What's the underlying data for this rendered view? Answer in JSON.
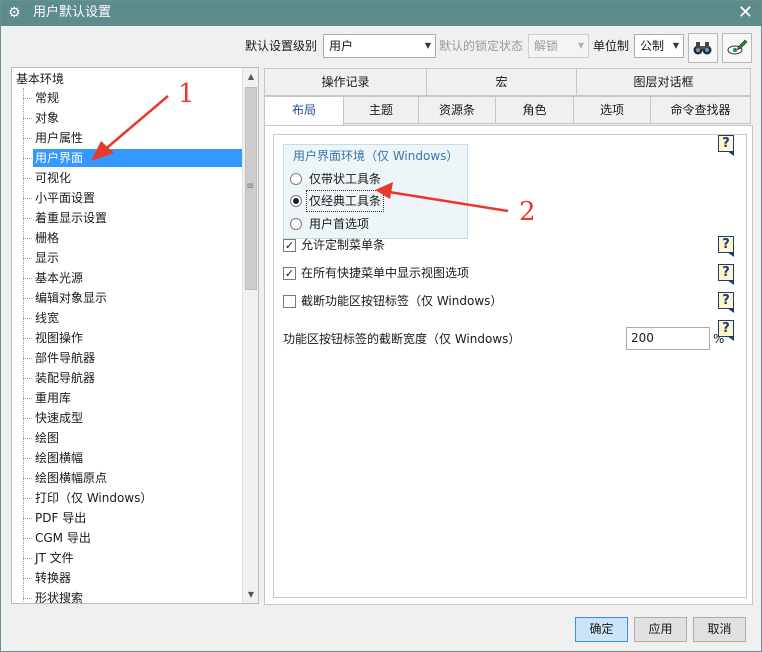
{
  "window": {
    "title": "用户默认设置",
    "app_icon": "gear-icon",
    "close_icon": "close-icon"
  },
  "toolbar": {
    "level_label": "默认设置级别",
    "level_value": "用户",
    "lock_label": "默认的锁定状态",
    "lock_value": "解锁",
    "unit_label": "单位制",
    "unit_value": "公制",
    "find_icon": "binoculars-icon",
    "tool_icon": "pencil-eye-icon"
  },
  "tree": {
    "root": "基本环境",
    "items": [
      "常规",
      "对象",
      "用户属性",
      "用户界面",
      "可视化",
      "小平面设置",
      "着重显示设置",
      "栅格",
      "显示",
      "基本光源",
      "编辑对象显示",
      "线宽",
      "视图操作",
      "部件导航器",
      "装配导航器",
      "重用库",
      "快速成型",
      "绘图",
      "绘图横幅",
      "绘图横幅原点",
      "打印（仅 Windows）",
      "PDF 导出",
      "CGM 导出",
      "JT 文件",
      "转换器",
      "形状搜索"
    ],
    "selected_index": 3
  },
  "tabs": {
    "row1": [
      "操作记录",
      "宏",
      "图层对话框"
    ],
    "row2": [
      "布局",
      "主题",
      "资源条",
      "角色",
      "选项",
      "命令查找器"
    ],
    "active": "布局"
  },
  "panel": {
    "group_title": "用户界面环境（仅 Windows）",
    "radios": [
      {
        "label": "仅带状工具条",
        "checked": false
      },
      {
        "label": "仅经典工具条",
        "checked": true
      },
      {
        "label": "用户首选项",
        "checked": false
      }
    ],
    "checks": [
      {
        "label": "允许定制菜单条",
        "checked": true
      },
      {
        "label": "在所有快捷菜单中显示视图选项",
        "checked": true
      },
      {
        "label": "截断功能区按钮标签（仅 Windows）",
        "checked": false
      }
    ],
    "width_label": "功能区按钮标签的截断宽度（仅 Windows）",
    "width_value": "200",
    "width_unit": "%",
    "help_glyph": "?"
  },
  "buttons": {
    "ok": "确定",
    "apply": "应用",
    "cancel": "取消"
  },
  "annotations": {
    "marker1": "1",
    "marker2": "2",
    "color": "#e8392b"
  }
}
